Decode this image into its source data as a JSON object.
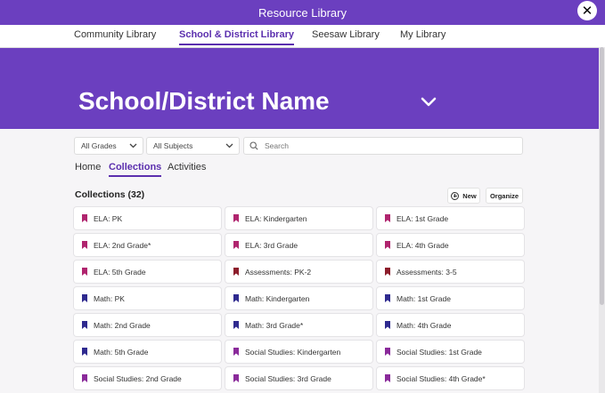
{
  "window": {
    "title": "Resource Library"
  },
  "top_tabs": [
    {
      "label": "Community Library",
      "active": false
    },
    {
      "label": "School & District Library",
      "active": true
    },
    {
      "label": "Seesaw Library",
      "active": false
    },
    {
      "label": "My Library",
      "active": false
    }
  ],
  "hero": {
    "title": "School/District Name"
  },
  "filters": {
    "grades": "All Grades",
    "subjects": "All Subjects",
    "search_placeholder": "Search"
  },
  "sub_tabs": [
    {
      "label": "Home",
      "active": false
    },
    {
      "label": "Collections",
      "active": true
    },
    {
      "label": "Activities",
      "active": false
    }
  ],
  "collections": {
    "title": "Collections (32)",
    "new_label": "New",
    "organize_label": "Organize",
    "items": [
      {
        "label": "ELA: PK",
        "color": "#b0246e"
      },
      {
        "label": "ELA: Kindergarten",
        "color": "#b0246e"
      },
      {
        "label": "ELA: 1st Grade",
        "color": "#b0246e"
      },
      {
        "label": "ELA: 2nd Grade*",
        "color": "#b0246e"
      },
      {
        "label": "ELA: 3rd Grade",
        "color": "#b0246e"
      },
      {
        "label": "ELA: 4th Grade",
        "color": "#b0246e"
      },
      {
        "label": "ELA: 5th Grade",
        "color": "#b0246e"
      },
      {
        "label": "Assessments: PK-2",
        "color": "#8c1d2b"
      },
      {
        "label": "Assessments: 3-5",
        "color": "#8c1d2b"
      },
      {
        "label": "Math: PK",
        "color": "#2f2a8f"
      },
      {
        "label": "Math: Kindergarten",
        "color": "#2f2a8f"
      },
      {
        "label": "Math: 1st Grade",
        "color": "#2f2a8f"
      },
      {
        "label": "Math: 2nd Grade",
        "color": "#2f2a8f"
      },
      {
        "label": "Math: 3rd Grade*",
        "color": "#2f2a8f"
      },
      {
        "label": "Math: 4th Grade",
        "color": "#2f2a8f"
      },
      {
        "label": "Math: 5th Grade",
        "color": "#2f2a8f"
      },
      {
        "label": "Social Studies: Kindergarten",
        "color": "#8a2a9a"
      },
      {
        "label": "Social Studies: 1st Grade",
        "color": "#8a2a9a"
      },
      {
        "label": "Social Studies: 2nd Grade",
        "color": "#8a2a9a"
      },
      {
        "label": "Social Studies: 3rd Grade",
        "color": "#8a2a9a"
      },
      {
        "label": "Social Studies: 4th Grade*",
        "color": "#8a2a9a"
      }
    ]
  }
}
